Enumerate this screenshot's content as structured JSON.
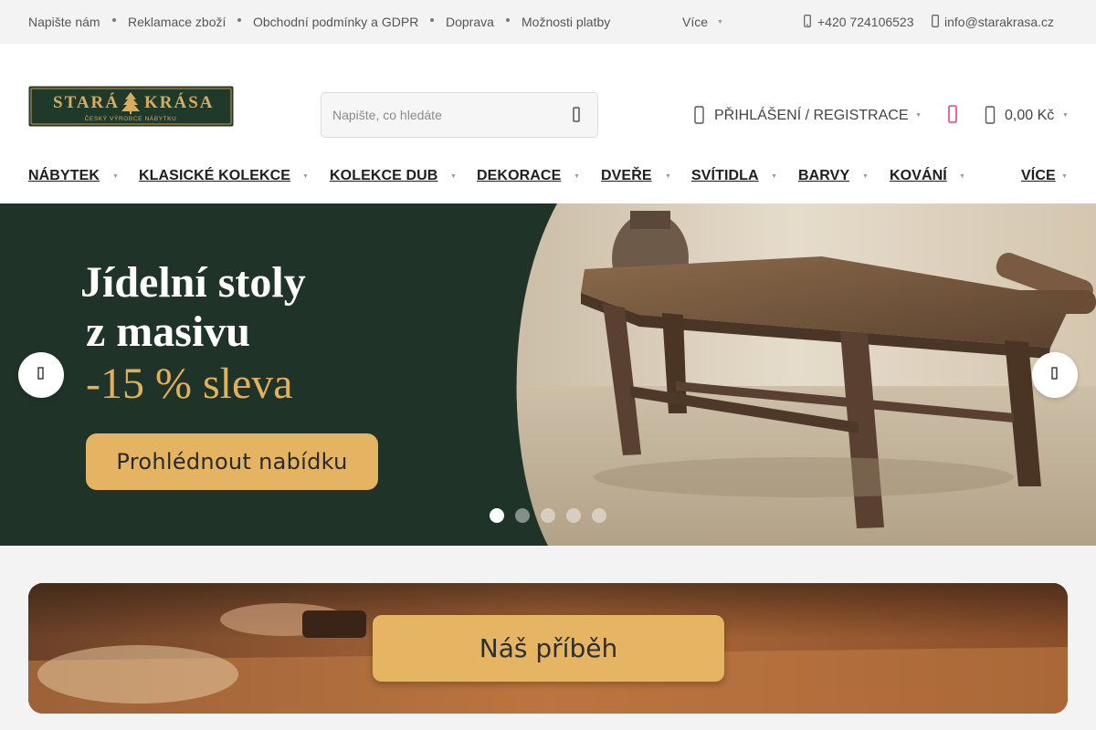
{
  "topbar": {
    "links": [
      "Napište nám",
      "Reklamace zboží",
      "Obchodní podmínky a GDPR",
      "Doprava",
      "Možnosti platby"
    ],
    "more_label": "Více",
    "phone": "+420 724106523",
    "email": "info@starakrasa.cz"
  },
  "header": {
    "logo": {
      "name": "STARÁ KRÁSA",
      "tagline": "ČESKÝ VÝROBCE NÁBYTKU"
    },
    "search": {
      "placeholder": "Napište, co hledáte"
    },
    "login_label": "PŘIHLÁŠENÍ / REGISTRACE",
    "cart_price": "0,00 Kč"
  },
  "nav": {
    "items": [
      "NÁBYTEK",
      "KLASICKÉ KOLEKCE",
      "KOLEKCE DUB",
      "DEKORACE",
      "DVEŘE",
      "SVÍTIDLA",
      "BARVY",
      "KOVÁNÍ"
    ],
    "more_label": "VÍCE"
  },
  "hero": {
    "title_line1": "Jídelní stoly",
    "title_line2": "z masivu",
    "sale": "-15 % sleva",
    "cta": "Prohlédnout nabídku",
    "slide_count": 5,
    "active_slide": 1
  },
  "story": {
    "cta": "Náš příběh"
  },
  "colors": {
    "hero_green": "#1f3329",
    "gold": "#e4b463",
    "sale_gold": "#e3b05a",
    "topbar_bg": "#f3f3f3",
    "wishlist_pink": "#e0457b"
  },
  "icons": {
    "phone": "phone-icon",
    "email": "email-icon",
    "search": "search-icon",
    "user": "user-icon",
    "wishlist": "heart-icon",
    "cart": "cart-icon",
    "prev": "chevron-left-icon",
    "next": "chevron-right-icon"
  }
}
